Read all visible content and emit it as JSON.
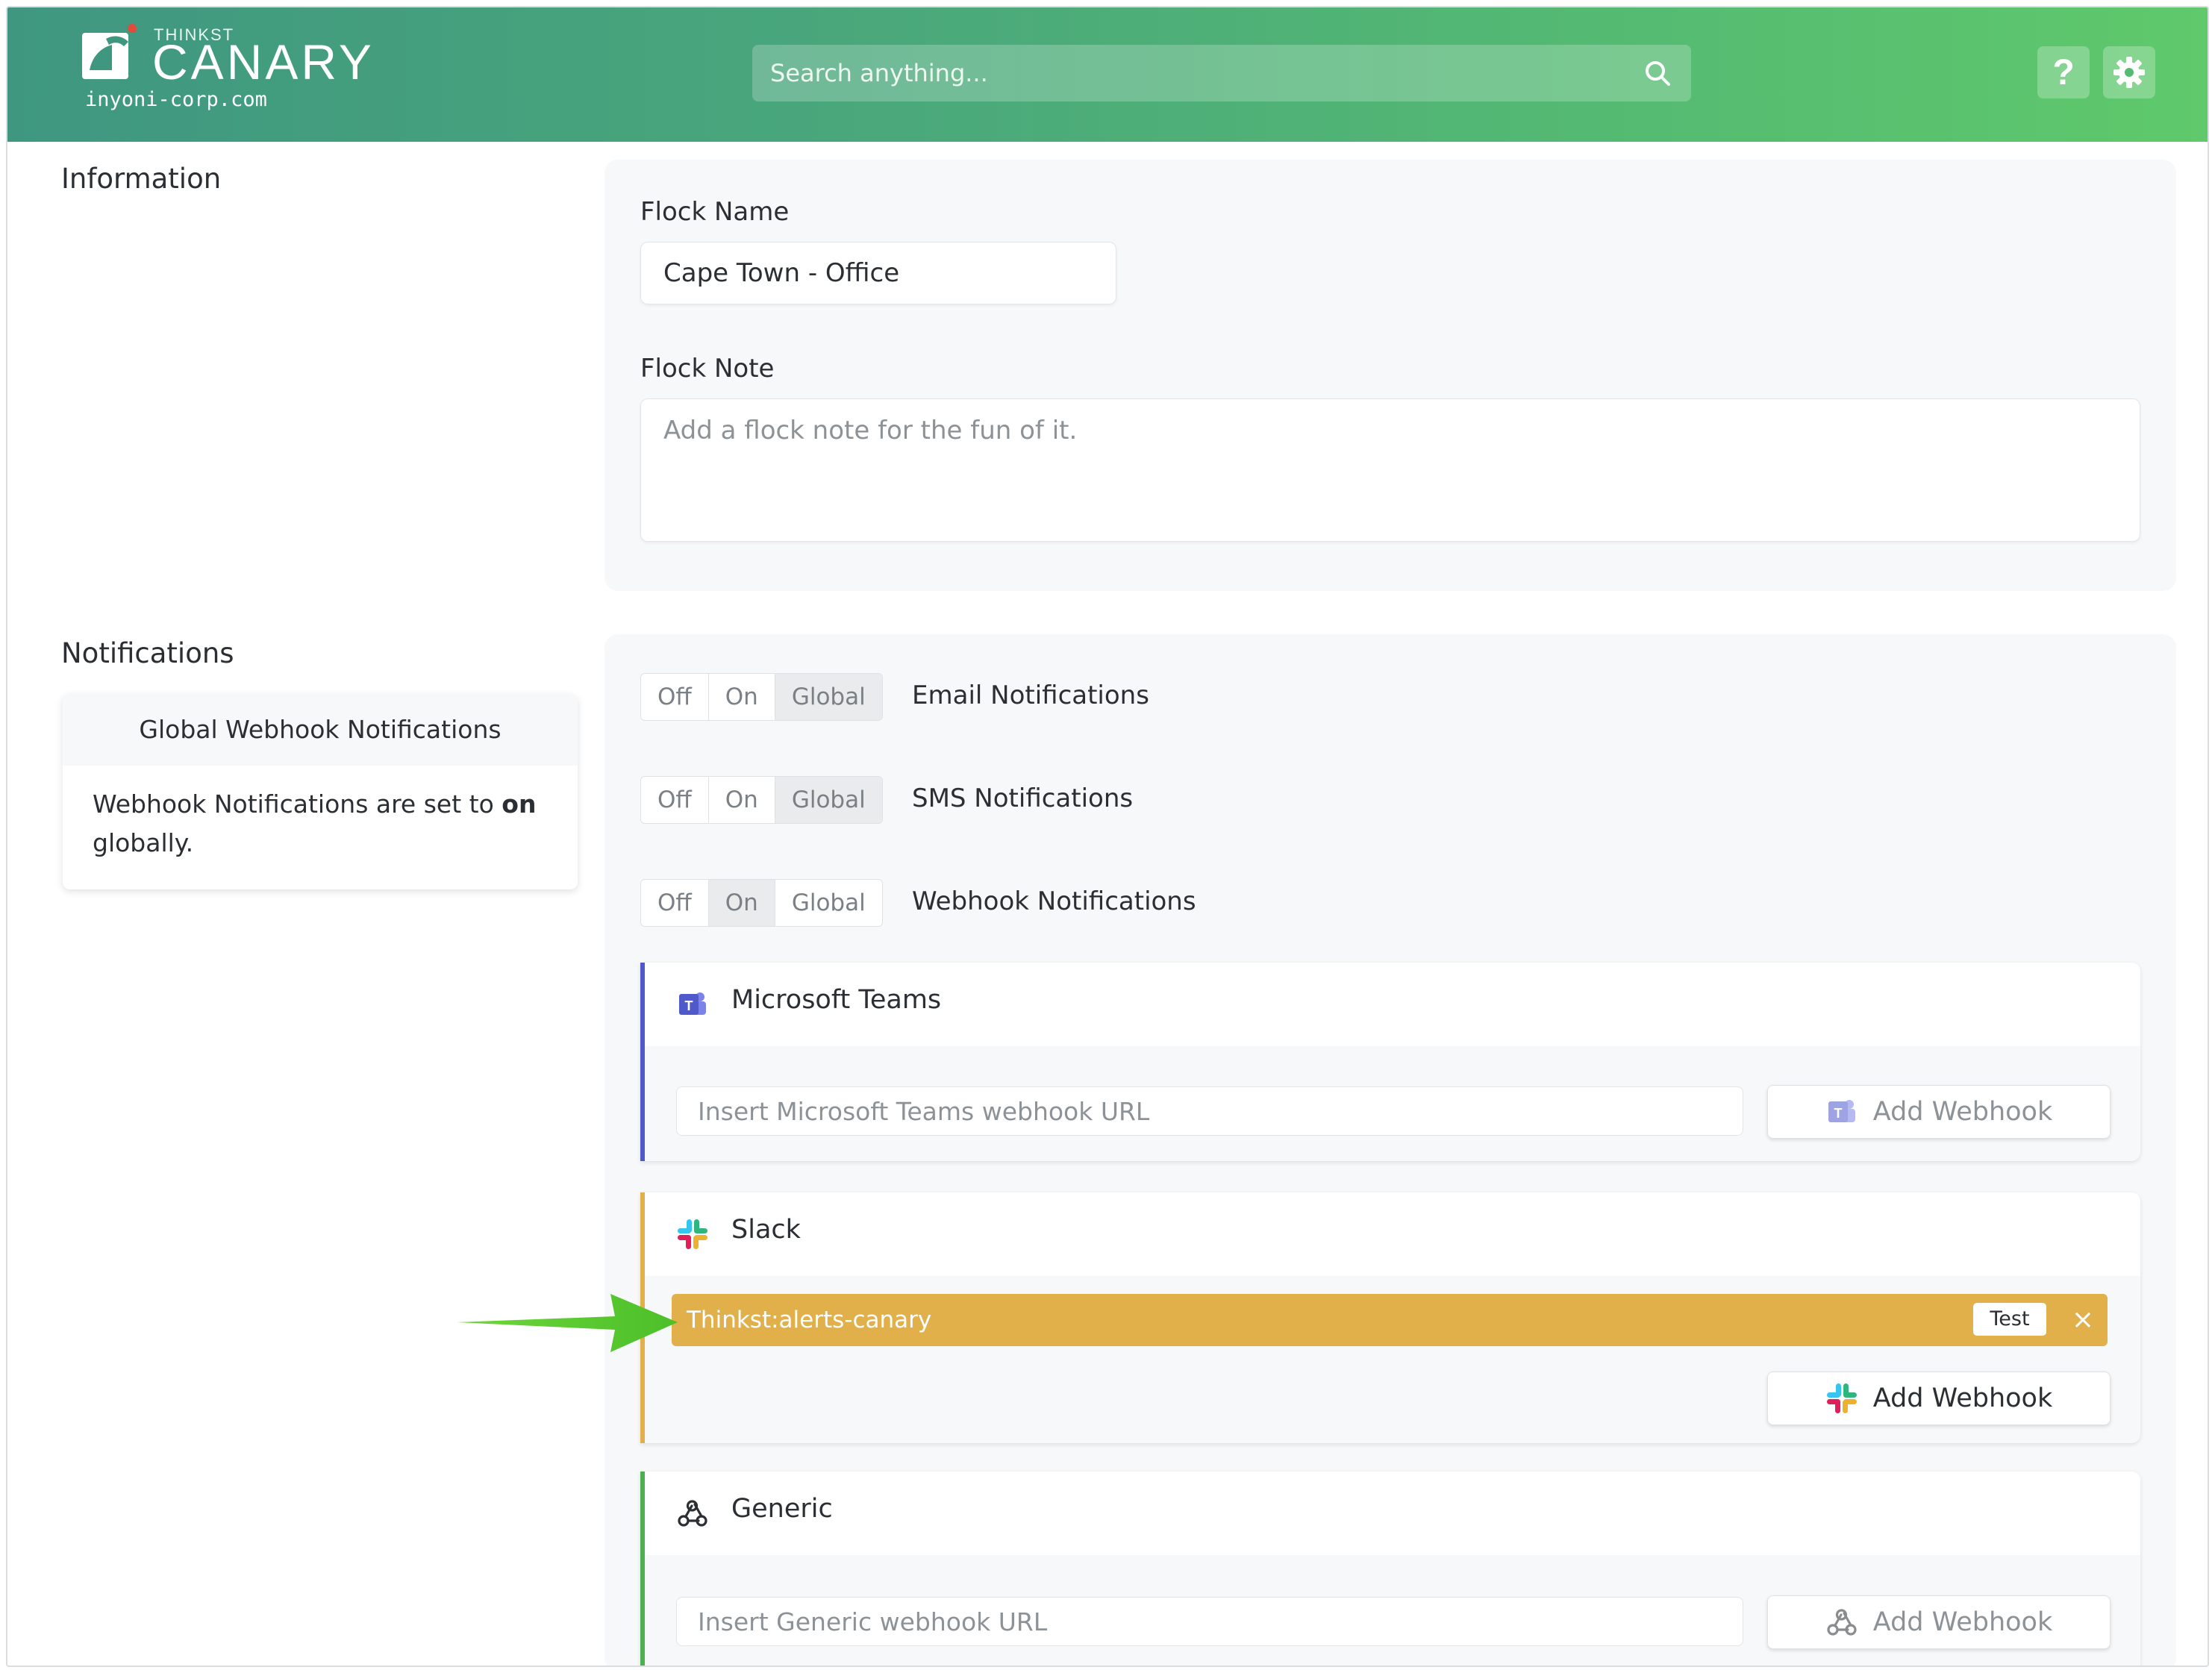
{
  "header": {
    "brand_small": "THINKST",
    "brand_big": "CANARY",
    "domain": "inyoni-corp.com",
    "search_placeholder": "Search anything...",
    "help_label": "?",
    "colors": {
      "gradient_start": "#3f9780",
      "gradient_end": "#5fc96b"
    }
  },
  "information": {
    "section_title": "Information",
    "flock_name_label": "Flock Name",
    "flock_name_value": "Cape Town - Office",
    "flock_note_label": "Flock Note",
    "flock_note_placeholder": "Add a flock note for the fun of it."
  },
  "notifications": {
    "section_title": "Notifications",
    "global_card": {
      "title": "Global Webhook Notifications",
      "text_before": "Webhook Notifications are set to ",
      "text_bold": "on",
      "text_after": " globally."
    },
    "toggles": [
      {
        "label": "Email Notifications",
        "options": [
          "Off",
          "On",
          "Global"
        ],
        "selected": "Global"
      },
      {
        "label": "SMS Notifications",
        "options": [
          "Off",
          "On",
          "Global"
        ],
        "selected": "Global"
      },
      {
        "label": "Webhook Notifications",
        "options": [
          "Off",
          "On",
          "Global"
        ],
        "selected": "On"
      }
    ],
    "integrations": {
      "teams": {
        "title": "Microsoft Teams",
        "icon": "microsoft-teams-icon",
        "color": "#5059c9",
        "input_placeholder": "Insert Microsoft Teams webhook URL",
        "button_label": "Add Webhook"
      },
      "slack": {
        "title": "Slack",
        "icon": "slack-icon",
        "color": "#e2b04b",
        "webhooks": [
          {
            "name": "Thinkst:alerts-canary",
            "test_label": "Test",
            "remove_label": "×"
          }
        ],
        "button_label": "Add Webhook"
      },
      "generic": {
        "title": "Generic",
        "icon": "webhook-icon",
        "color": "#4caf50",
        "input_placeholder": "Insert Generic webhook URL",
        "button_label": "Add Webhook"
      }
    }
  }
}
